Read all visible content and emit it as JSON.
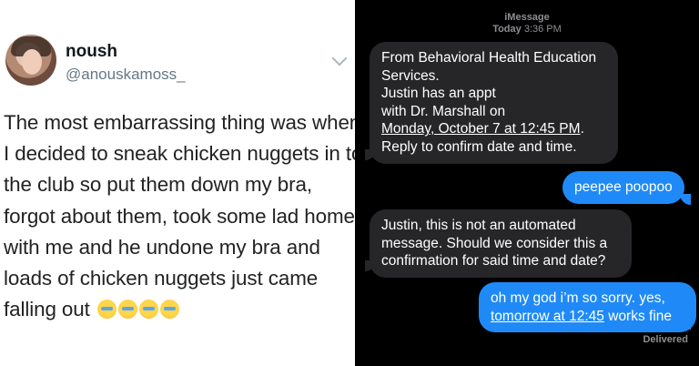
{
  "tweet": {
    "name": "noush",
    "handle": "@anouskamoss_",
    "lines": [
      "The most embarrassing thing was when",
      "I decided to sneak chicken nuggets in to",
      "the club so put them down my bra,",
      "forgot about them, took some lad home",
      "with me and he undone my bra and",
      "loads of chicken nuggets just came",
      "falling out"
    ],
    "emoji_count": 4,
    "emoji_icon": "loudly-crying-face-icon"
  },
  "imessage": {
    "service": "iMessage",
    "day": "Today",
    "time": "3:36 PM",
    "messages": {
      "m1": {
        "l1": "From Behavioral Health Education",
        "l2": "Services.",
        "l3": "Justin has an appt",
        "l4": "with Dr. Marshall on",
        "l5": "Monday, October 7 at 12:45 PM",
        "l5_end": ".",
        "l6": "Reply to confirm date and time."
      },
      "m2": "peepee poopoo",
      "m3": {
        "l1": "Justin, this is not an automated",
        "l2": "message. Should we consider this a",
        "l3": "confirmation for said time and date?"
      },
      "m4": {
        "l1": "oh my god i’m so sorry. yes,",
        "l2": "tomorrow at 12:45",
        "l2_end": " works fine"
      }
    },
    "status": "Delivered"
  },
  "colors": {
    "outgoing_bubble": "#1f8af7",
    "incoming_bubble": "#262628",
    "meta_text": "#8e8e93"
  }
}
